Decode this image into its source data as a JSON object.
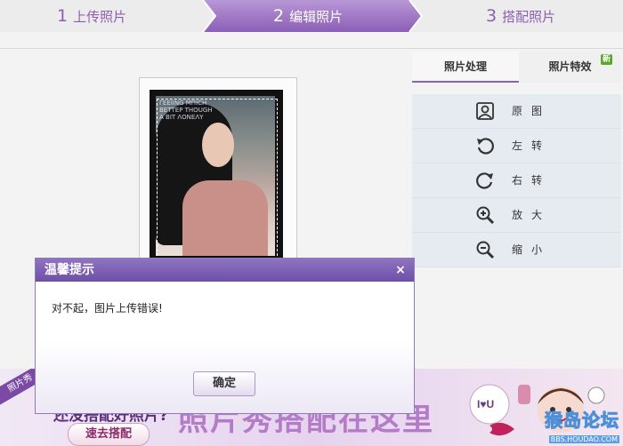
{
  "steps": [
    {
      "num": "1",
      "label": "上传照片",
      "active": false
    },
    {
      "num": "2",
      "label": "编辑照片",
      "active": true
    },
    {
      "num": "3",
      "label": "搭配照片",
      "active": false
    }
  ],
  "colors": {
    "accent": "#8463b0",
    "step_active": "#a078c8",
    "dialog_title": "#6d4fa8"
  },
  "photo": {
    "overlay_text": "ΓΕΕΙΙΝG ΜΠΙCΗ\nΒΕΤΤΕΡ ΤΗΟUGΗ\nΑ ΒΙΤ ΛΟΝΕΛΥ"
  },
  "panel": {
    "tabs": [
      {
        "label": "照片处理",
        "active": true
      },
      {
        "label": "照片特效",
        "badge": "新"
      }
    ],
    "tools": [
      {
        "label": "原图",
        "icon": "portrait-icon"
      },
      {
        "label": "左转",
        "icon": "rotate-left-icon"
      },
      {
        "label": "右转",
        "icon": "rotate-right-icon"
      },
      {
        "label": "放大",
        "icon": "zoom-in-icon"
      },
      {
        "label": "缩小",
        "icon": "zoom-out-icon"
      }
    ]
  },
  "banner": {
    "corner_label": "照片秀",
    "subtitle": "还没搭配好照片?",
    "headline": "照片秀搭配在这里",
    "button_label": "速去搭配",
    "watermark_big": "猴岛论坛",
    "watermark_small": "BBS.HOUDAO.COM"
  },
  "dialog": {
    "title": "温馨提示",
    "close_symbol": "×",
    "message": "对不起，图片上传错误!",
    "ok_label": "确定"
  }
}
